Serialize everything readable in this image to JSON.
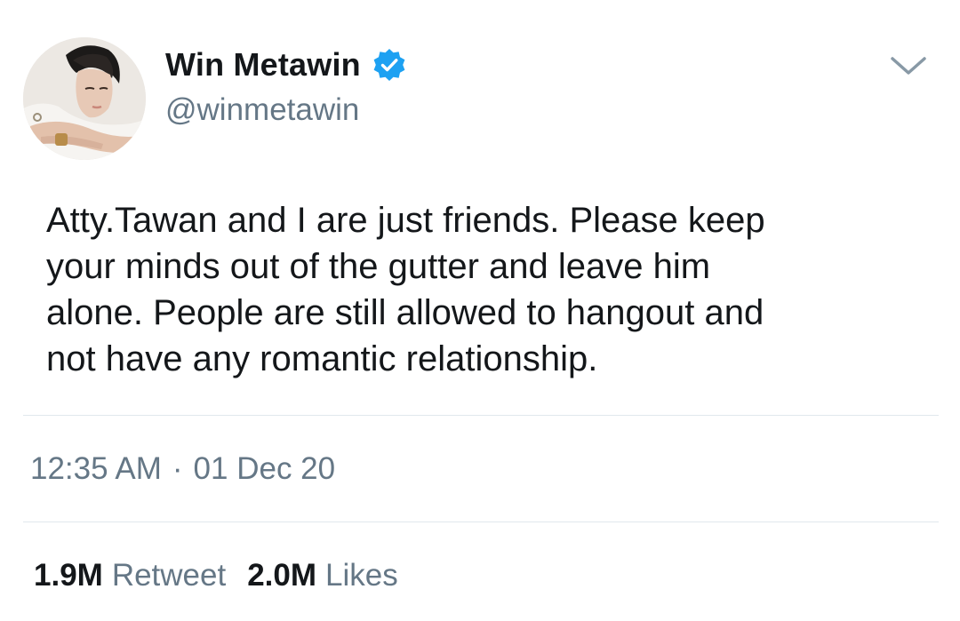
{
  "author": {
    "display_name": "Win Metawin",
    "handle": "@winmetawin",
    "verified": true
  },
  "tweet": {
    "text": "Atty.Tawan and I are just friends. Please keep\nyour minds out of the gutter and leave him\nalone. People are still allowed to hangout and\nnot have any romantic relationship."
  },
  "meta": {
    "time": "12:35 AM",
    "separator": "·",
    "date": "01 Dec 20"
  },
  "stats": {
    "retweets_count": "1.9M",
    "retweets_label": "Retweet",
    "likes_count": "2.0M",
    "likes_label": "Likes"
  },
  "icons": {
    "verified": "verified-badge-icon",
    "menu": "chevron-down-icon"
  },
  "colors": {
    "verified_blue": "#1da1f2",
    "secondary_text": "#657786",
    "primary_text": "#14171a",
    "divider": "#e1e8ed"
  }
}
